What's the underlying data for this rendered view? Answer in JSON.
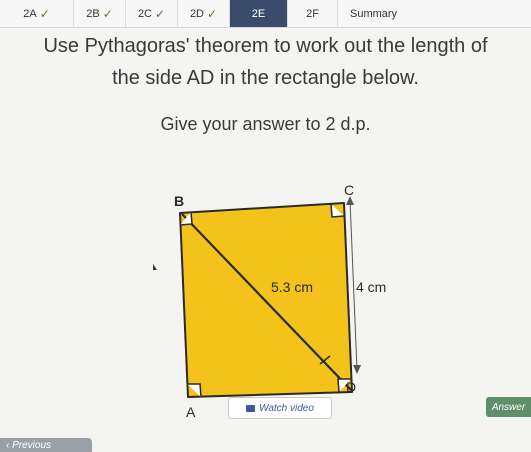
{
  "tabs": [
    {
      "label": "2A",
      "done": true
    },
    {
      "label": "2B",
      "done": true
    },
    {
      "label": "2C",
      "done": true
    },
    {
      "label": "2D",
      "done": true
    },
    {
      "label": "2E",
      "done": false,
      "active": true
    },
    {
      "label": "2F",
      "done": false
    },
    {
      "label": "Summary",
      "done": false
    }
  ],
  "check_glyph": "✓",
  "question": {
    "line1": "Use Pythagoras' theorem to work out the length of",
    "line2": "the side AD in the rectangle below.",
    "instruction": "Give your answer to 2 d.p."
  },
  "figure": {
    "vertex_a": "A",
    "vertex_b": "B",
    "vertex_c": "C",
    "vertex_d": "D",
    "diagonal_label": "5.3 cm",
    "side_label": "4 cm",
    "fill_color": "#f3c21b"
  },
  "buttons": {
    "watch_video": "Watch video",
    "answer": "Answer",
    "previous": "‹ Previous"
  },
  "colors": {
    "active_tab": "#3a4a6b",
    "answer_button": "#5f8f6a",
    "check": "#4a7c3a"
  }
}
